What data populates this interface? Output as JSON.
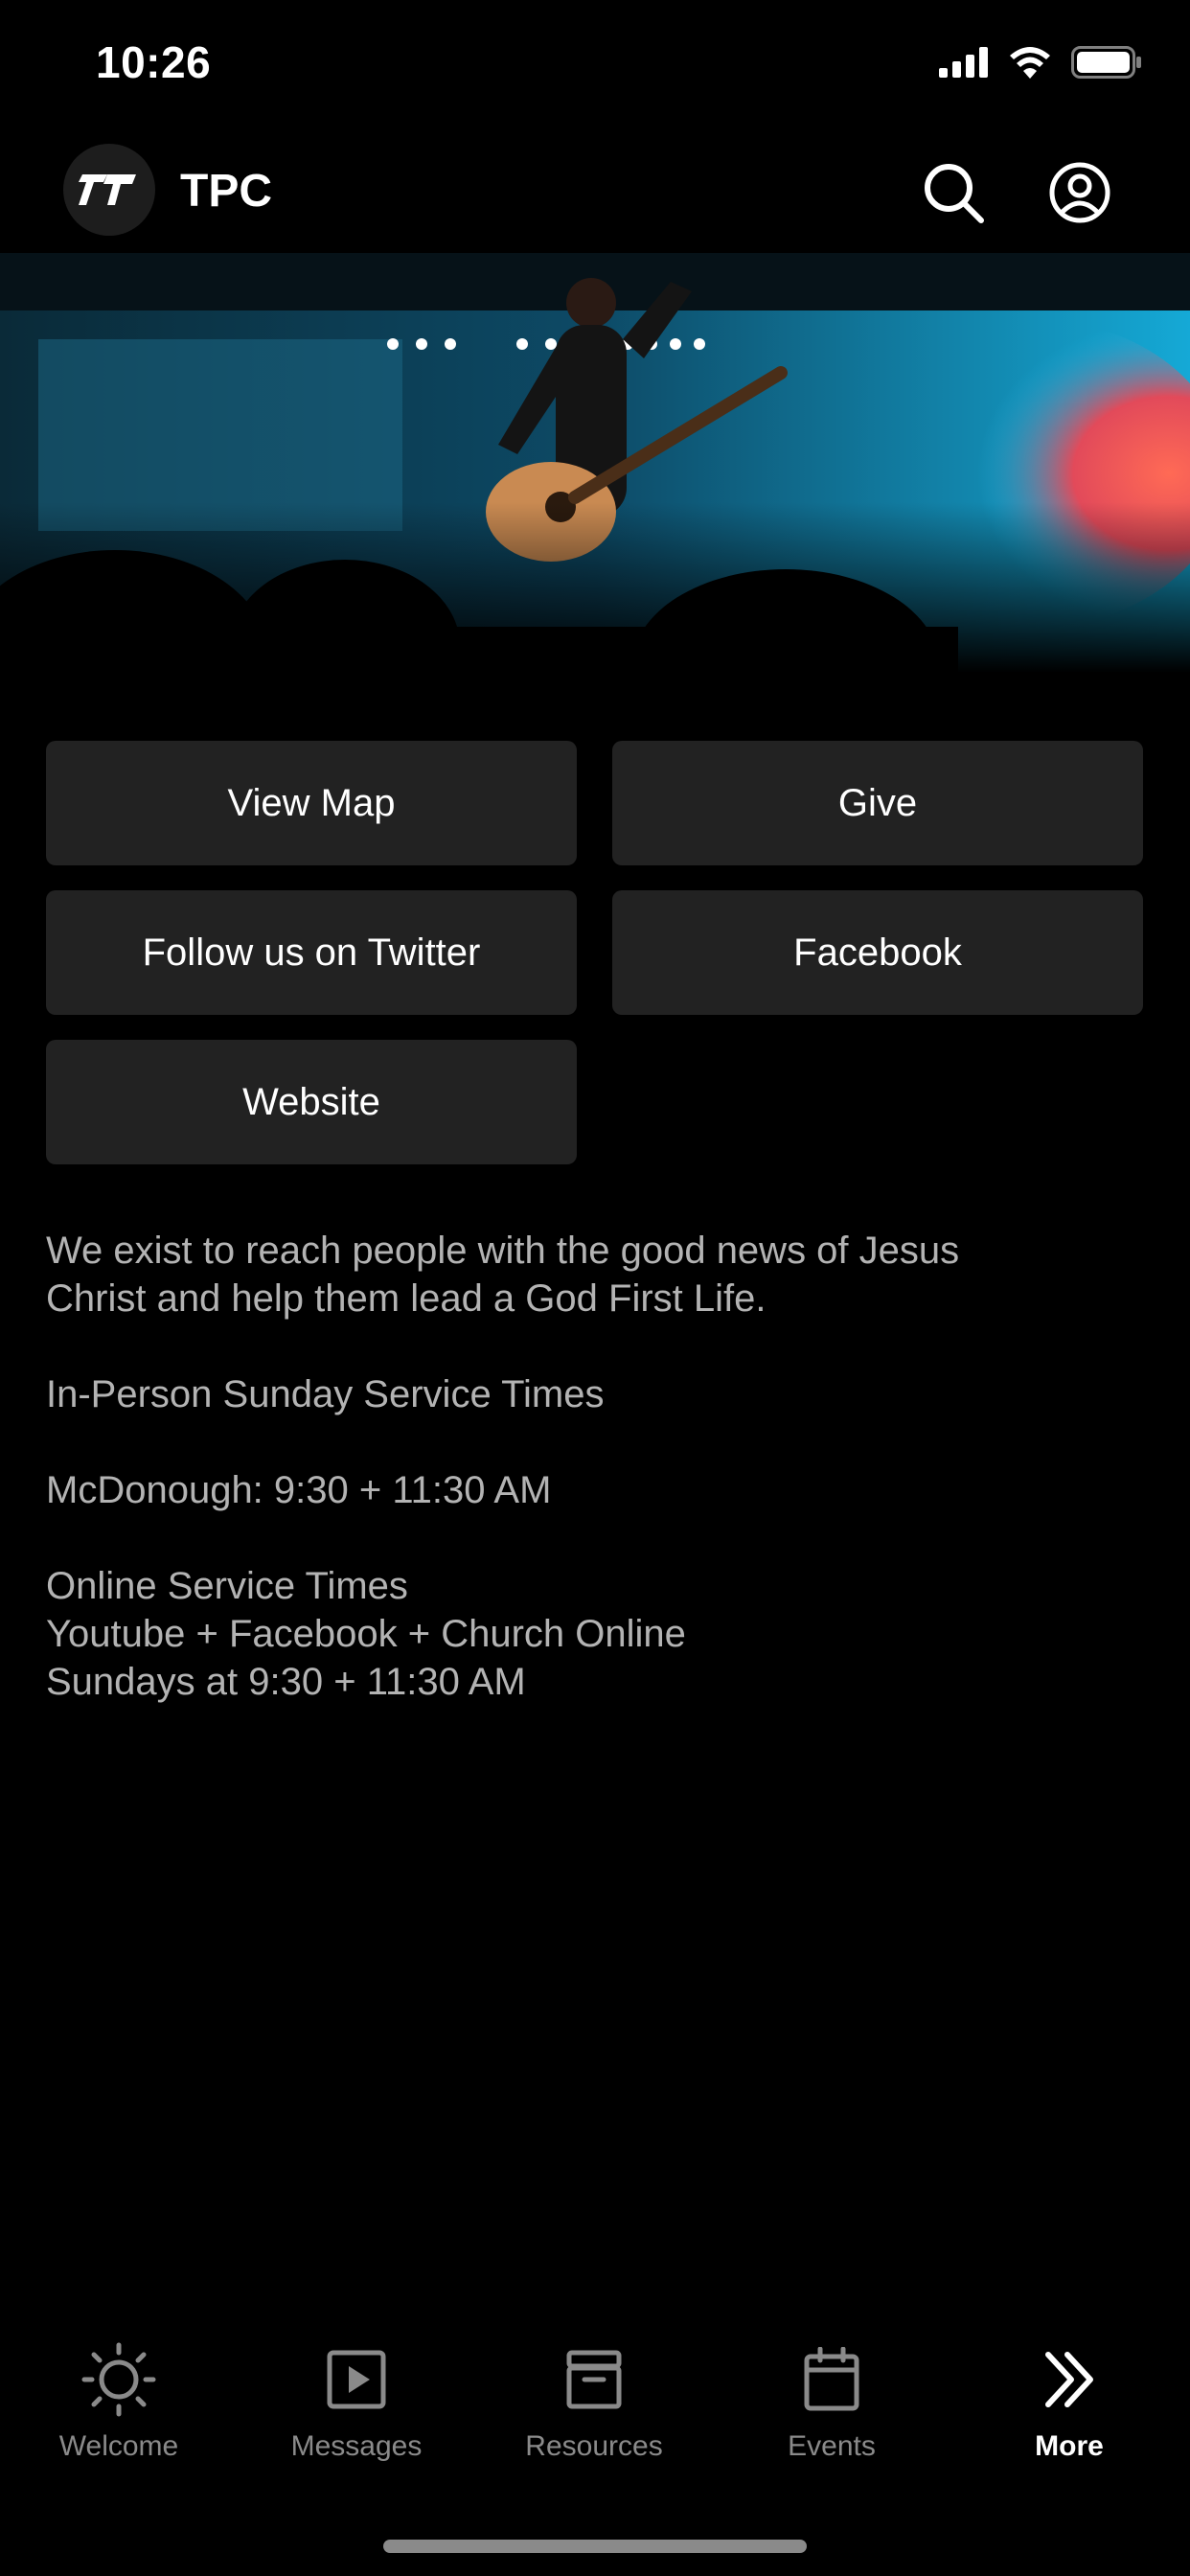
{
  "status": {
    "time": "10:26"
  },
  "header": {
    "title": "TPC",
    "logo_icon": "tpc-logo",
    "search_icon": "search-icon",
    "account_icon": "user-circle-icon"
  },
  "buttons": {
    "view_map": "View Map",
    "give": "Give",
    "twitter": "Follow us on Twitter",
    "facebook": "Facebook",
    "website": "Website"
  },
  "about": {
    "mission": "We exist to reach people with the good news of Jesus\nChrist and help them lead a God First Life.",
    "service_heading": "In-Person Sunday Service Times",
    "mcdonough": "McDonough: 9:30 + 11:30 AM",
    "online": "Online Service Times\nYoutube + Facebook + Church Online\nSundays at 9:30 + 11:30 AM"
  },
  "tabs": [
    {
      "label": "Welcome",
      "icon": "sun-icon"
    },
    {
      "label": "Messages",
      "icon": "play-square-icon"
    },
    {
      "label": "Resources",
      "icon": "archive-box-icon"
    },
    {
      "label": "Events",
      "icon": "calendar-icon"
    },
    {
      "label": "More",
      "icon": "double-chevron-right-icon",
      "active": true
    }
  ],
  "colors": {
    "background": "#000000",
    "button_bg": "#222222",
    "body_text": "#b3b3b3",
    "inactive_tab": "#8a8a8a"
  }
}
